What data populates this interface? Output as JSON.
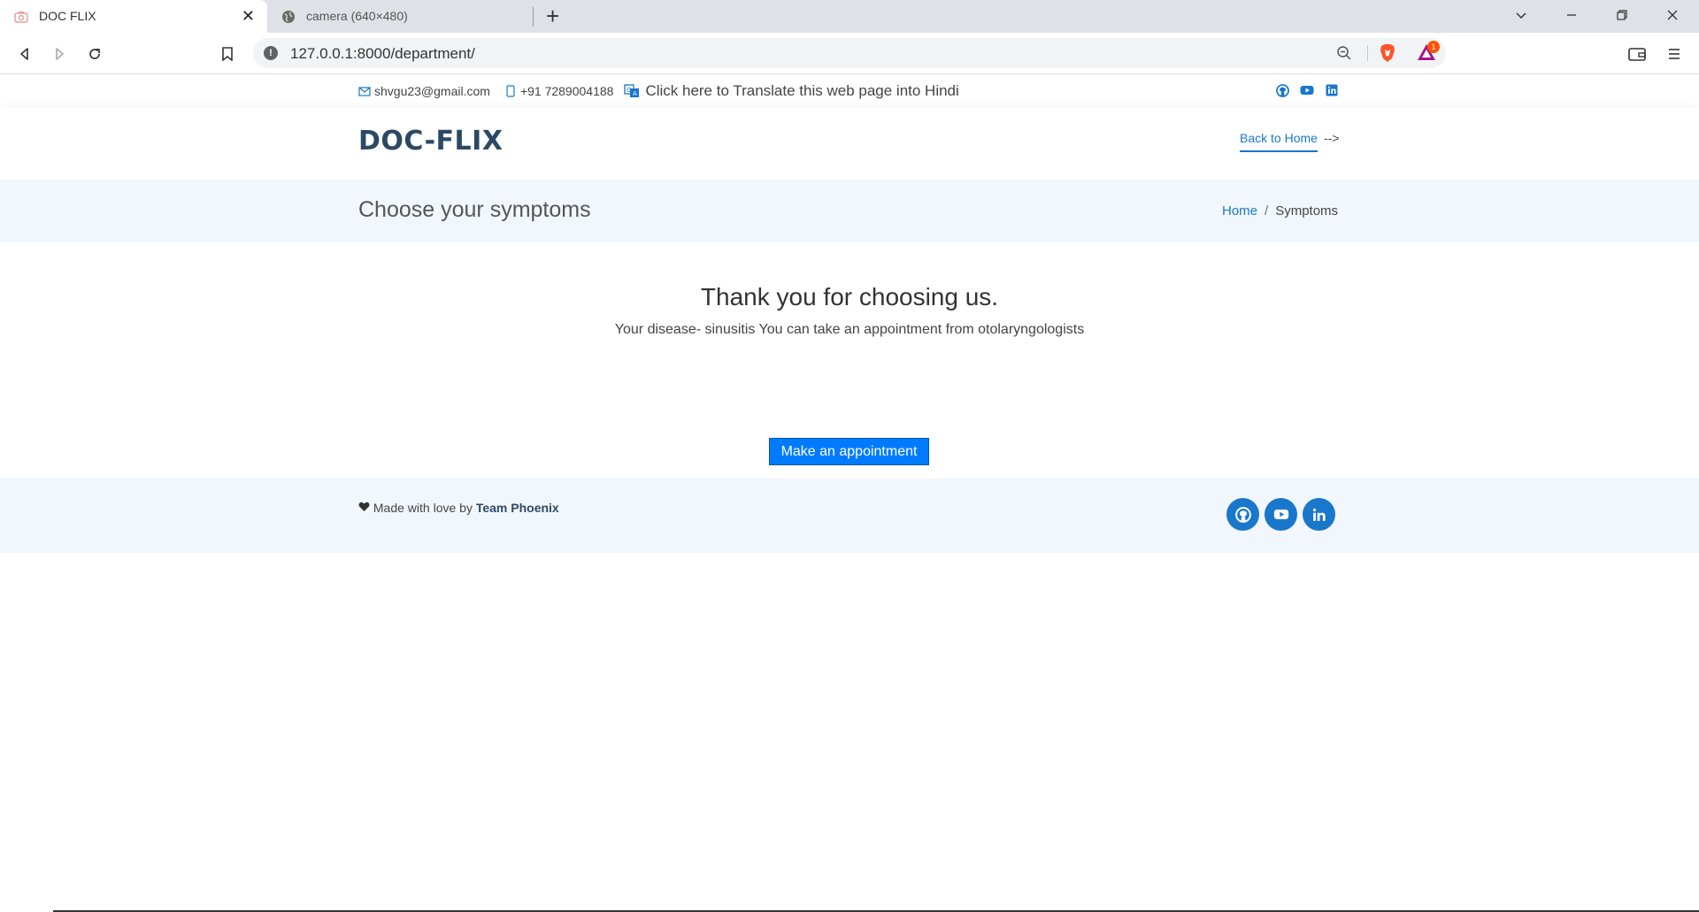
{
  "browser": {
    "tabs": [
      {
        "title": "DOC FLIX",
        "icon": "camera-icon",
        "active": true
      },
      {
        "title": "camera (640×480)",
        "icon": "globe-icon",
        "active": false
      }
    ],
    "url": "127.0.0.1:8000/department/",
    "rewards_badge": "1"
  },
  "topbar": {
    "email": "shvgu23@gmail.com",
    "phone": "+91 7289004188",
    "translate": "Click here to Translate this web page into Hindi"
  },
  "header": {
    "logo": "DOC-FLIX",
    "back_link": "Back to Home",
    "back_suffix": "-->"
  },
  "breadcrumbs": {
    "title": "Choose your symptoms",
    "home": "Home",
    "separator": "/",
    "current": "Symptoms"
  },
  "result": {
    "heading": "Thank you for choosing us.",
    "message": "Your disease- sinusitis You can take an appointment from otolaryngologists",
    "button": "Make an appointment"
  },
  "footer": {
    "credit_prefix": "Made with love by",
    "team": "Team Phoenix"
  },
  "colors": {
    "accent": "#1977cc",
    "heading": "#2c4964",
    "button": "#007bff",
    "section_bg": "#f1f7fd"
  }
}
